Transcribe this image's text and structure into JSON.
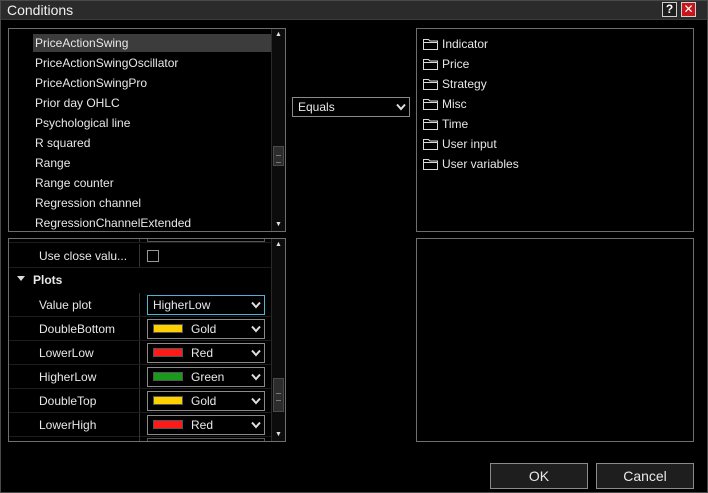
{
  "window": {
    "title": "Conditions",
    "help_label": "?",
    "close_label": "✕"
  },
  "indicator_list": {
    "items": [
      {
        "label": "PriceActionSwing",
        "selected": true
      },
      {
        "label": "PriceActionSwingOscillator",
        "selected": false
      },
      {
        "label": "PriceActionSwingPro",
        "selected": false
      },
      {
        "label": "Prior day OHLC",
        "selected": false
      },
      {
        "label": "Psychological line",
        "selected": false
      },
      {
        "label": "R squared",
        "selected": false
      },
      {
        "label": "Range",
        "selected": false
      },
      {
        "label": "Range counter",
        "selected": false
      },
      {
        "label": "Regression channel",
        "selected": false
      },
      {
        "label": "RegressionChannelExtended",
        "selected": false
      }
    ]
  },
  "operator": {
    "value": "Equals",
    "icon": "chevron-down-icon"
  },
  "categories": {
    "icon": "folder-icon",
    "items": [
      "Indicator",
      "Price",
      "Strategy",
      "Misc",
      "Time",
      "User input",
      "User variables"
    ]
  },
  "properties": {
    "use_close_label": "Use close valu...",
    "use_close_checked": false,
    "plots_label": "Plots",
    "rows": [
      {
        "label": "Value plot",
        "value": "HigherLow",
        "color": null
      },
      {
        "label": "DoubleBottom",
        "value": "Gold",
        "color": "#ffd000"
      },
      {
        "label": "LowerLow",
        "value": "Red",
        "color": "#ff1a1a"
      },
      {
        "label": "HigherLow",
        "value": "Green",
        "color": "#1a9a1a"
      },
      {
        "label": "DoubleTop",
        "value": "Gold",
        "color": "#ffd000"
      },
      {
        "label": "LowerHigh",
        "value": "Red",
        "color": "#ff1a1a"
      }
    ]
  },
  "buttons": {
    "ok": "OK",
    "cancel": "Cancel"
  },
  "colors": {
    "accent_focus": "#4fb3d9",
    "close_button": "#c8141b",
    "selection": "#3c3c3c"
  }
}
